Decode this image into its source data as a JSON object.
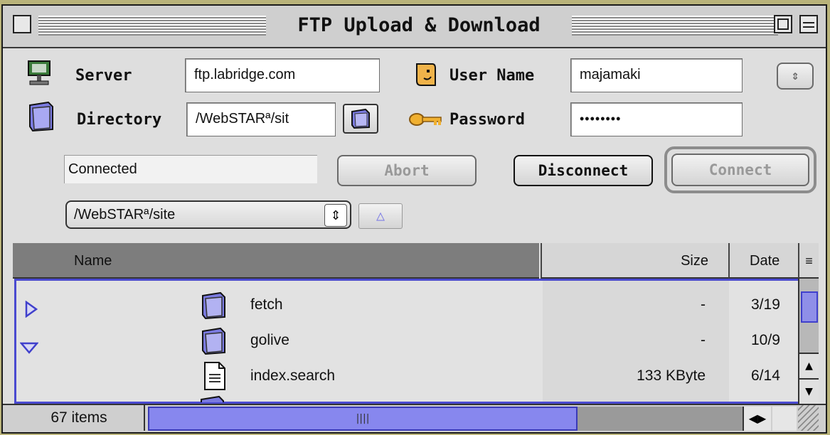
{
  "window": {
    "title": "FTP Upload & Download"
  },
  "form": {
    "server_label": "Server",
    "server_value": "ftp.labridge.com",
    "directory_label": "Directory",
    "directory_value": "/WebSTARª/sit",
    "username_label": "User Name",
    "username_value": "majamaki",
    "password_label": "Password",
    "password_value": "••••••••"
  },
  "status": {
    "text": "Connected"
  },
  "buttons": {
    "abort": "Abort",
    "disconnect": "Disconnect",
    "connect": "Connect"
  },
  "path_popup": {
    "selected": "/WebSTARª/site"
  },
  "table": {
    "columns": {
      "name": "Name",
      "size": "Size",
      "date": "Date"
    },
    "rows": [
      {
        "name": "fetch",
        "size": "-",
        "date": "3/19",
        "kind": "folder",
        "disclosure": "collapsed"
      },
      {
        "name": "golive",
        "size": "-",
        "date": "10/9",
        "kind": "folder",
        "disclosure": "expanded"
      },
      {
        "name": "index.search",
        "size": "133 KByte",
        "date": "6/14",
        "kind": "file",
        "disclosure": "none"
      }
    ]
  },
  "footer": {
    "item_count": "67 items"
  },
  "colors": {
    "accent": "#7f7fe6",
    "selection_border": "#4040cc",
    "desktop": "#b9b37a"
  }
}
